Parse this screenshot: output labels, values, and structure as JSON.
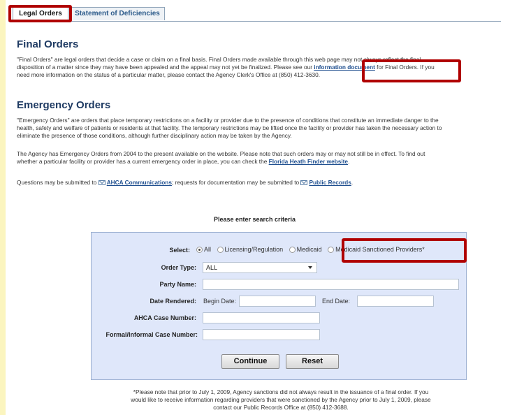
{
  "tabs": [
    {
      "label": "Legal Orders"
    },
    {
      "label": "Statement of Deficiencies"
    }
  ],
  "final_orders": {
    "heading": "Final Orders",
    "lines": [
      "\"Final Orders\" are legal orders that decide a case or claim on a final basis. Final Orders made available through this web page may not always reflect the final",
      "disposition of a matter since they may have been appealed and the appeal may not yet be finalized. Please see our ",
      "need more information on the status of a particular matter, please contact the Agency Clerk's Office at (850) 412-3630."
    ],
    "link": "information document",
    "line2_tail": " for Final Orders. If you"
  },
  "emergency_orders": {
    "heading": "Emergency Orders",
    "p1": [
      "\"Emergency Orders\" are orders that place temporary restrictions on a facility or provider due to the presence of conditions that constitute an immediate danger to the",
      "health, safety and welfare of patients or residents at that facility. The temporary restrictions may be lifted once the facility or provider has taken the necessary action to",
      "eliminate the presence of those conditions, although further disciplinary action may be taken by the Agency."
    ],
    "p2": [
      "The Agency has Emergency Orders from 2004 to the present available on the website. Please note that such orders may or may not still be in effect. To find out",
      "whether a particular facility or provider has a current emergency order in place, you can check the "
    ],
    "p2_link": "Florida Heath Finder website",
    "p2_end": ".",
    "questions_pre": "Questions may be submitted to ",
    "questions_link1": "AHCA Communications",
    "questions_mid": "; requests for documentation may be submitted to ",
    "questions_link2": "Public Records",
    "questions_end": "."
  },
  "search": {
    "title": "Please enter search criteria",
    "select_label": "Select:",
    "options": [
      "All",
      "Licensing/Regulation",
      "Medicaid",
      "Medicaid Sanctioned Providers*"
    ],
    "order_type_label": "Order Type:",
    "order_type_value": "ALL",
    "party_name_label": "Party Name:",
    "date_rendered_label": "Date Rendered:",
    "begin_date_label": "Begin Date:",
    "end_date_label": "End Date:",
    "ahca_case_label": "AHCA Case Number:",
    "formal_case_label": "Formal/Informal Case Number:",
    "continue_label": "Continue",
    "reset_label": "Reset"
  },
  "footnote": [
    "*Please note that prior to July 1, 2009, Agency sanctions did not always result in the issuance of a final order. If you",
    "would like to receive information regarding providers that were sanctioned by the Agency prior to July 1, 2009, please",
    "contact our Public Records Office at (850) 412-3688."
  ],
  "highlight_color": "#b00000"
}
